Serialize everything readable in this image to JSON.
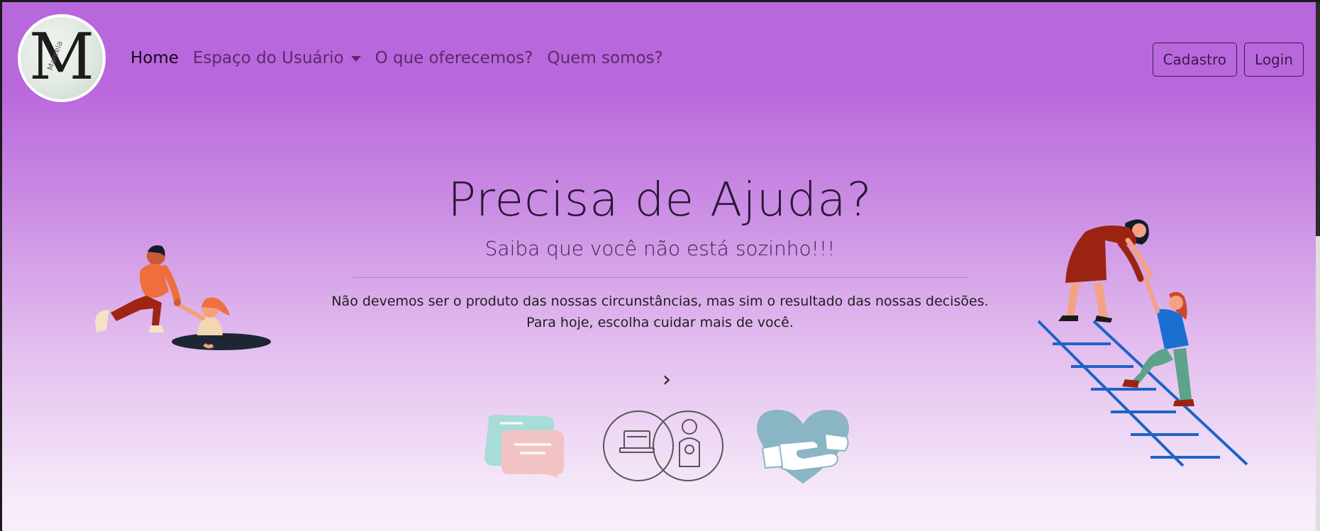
{
  "brand": {
    "logo_letter": "M",
    "logo_signature": "Marcela"
  },
  "nav": {
    "items": [
      {
        "label": "Home",
        "active": true
      },
      {
        "label": "Espaço do Usuário",
        "dropdown": true
      },
      {
        "label": "O que oferecemos?"
      },
      {
        "label": "Quem somos?"
      }
    ],
    "cadastro": "Cadastro",
    "login": "Login"
  },
  "hero": {
    "title": "Precisa de Ajuda?",
    "lead": "Saiba que você não está sozinho!!!",
    "quote_line1": "Não devemos ser o produto das nossas circunstâncias, mas sim o resultado das nossas decisões.",
    "quote_line2": "Para hoje, escolha cuidar mais de você.",
    "carousel_next": "›"
  },
  "icons": {
    "left_illustration": "helping-hand-illustration-icon",
    "right_illustration": "ladder-help-illustration-icon",
    "services": [
      "chat-bubbles-icon",
      "online-therapy-icon",
      "heart-hands-icon"
    ]
  },
  "colors": {
    "background_top": "#b967dc",
    "background_bottom": "#f8eef9",
    "nav_text": "#5a2a6e",
    "button_border": "#3b1a4b"
  }
}
